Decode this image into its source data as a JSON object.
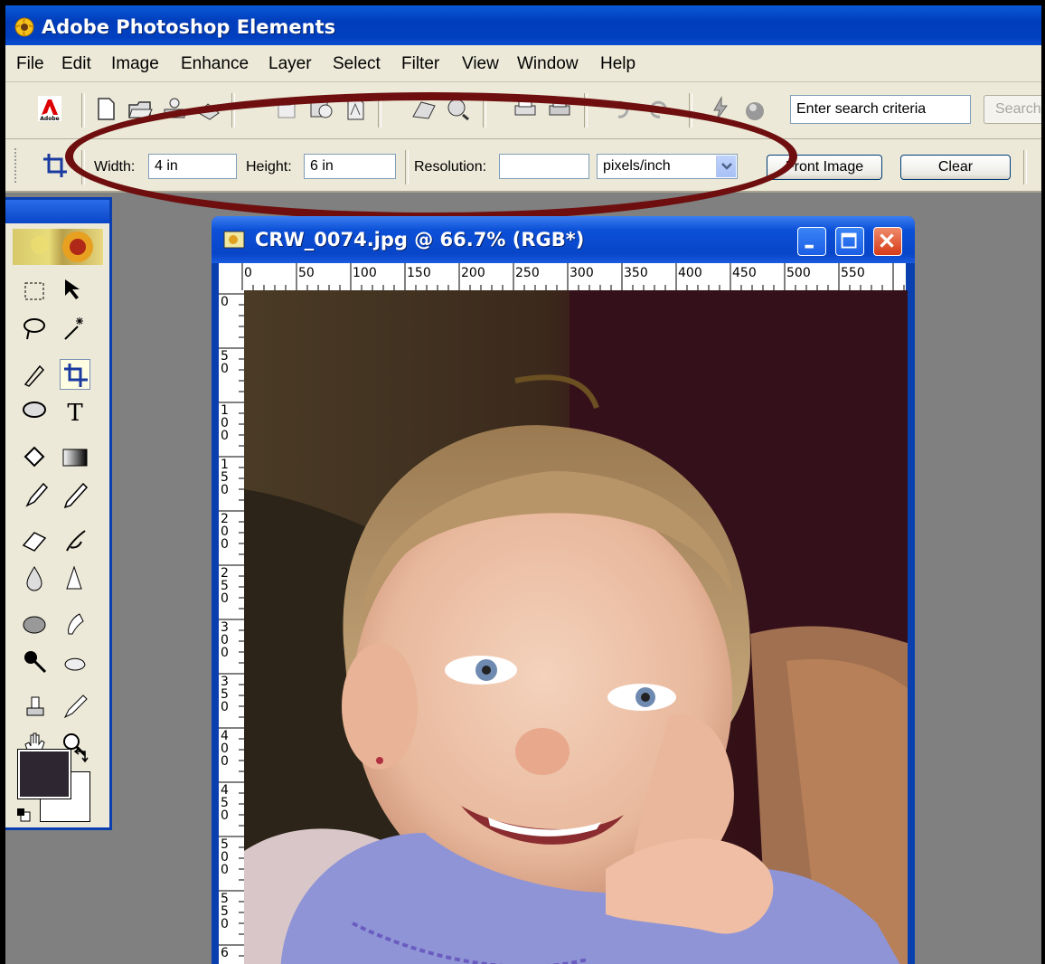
{
  "app": {
    "title": "Adobe Photoshop Elements"
  },
  "menu": [
    "File",
    "Edit",
    "Image",
    "Enhance",
    "Layer",
    "Select",
    "Filter",
    "View",
    "Window",
    "Help"
  ],
  "shortcuts": {
    "search_placeholder": "Enter search criteria",
    "search_button": "Search"
  },
  "options": {
    "width_label": "Width:",
    "width_value": "4 in",
    "height_label": "Height:",
    "height_value": "6 in",
    "resolution_label": "Resolution:",
    "resolution_value": "",
    "resolution_unit": "pixels/inch",
    "front_image_button": "Front Image",
    "clear_button": "Clear"
  },
  "document": {
    "title": "CRW_0074.jpg @ 66.7% (RGB*)",
    "ruler_h": [
      "0",
      "50",
      "100",
      "150",
      "200",
      "250",
      "300",
      "350",
      "400",
      "450",
      "500",
      "550"
    ],
    "ruler_v": [
      "0",
      "50",
      "100",
      "150",
      "200",
      "250",
      "300",
      "350",
      "400",
      "450",
      "500",
      "550",
      "6"
    ]
  },
  "colors": {
    "foreground": "#2e2630",
    "background": "#ffffff",
    "highlight_oval": "#6e0e0e"
  }
}
